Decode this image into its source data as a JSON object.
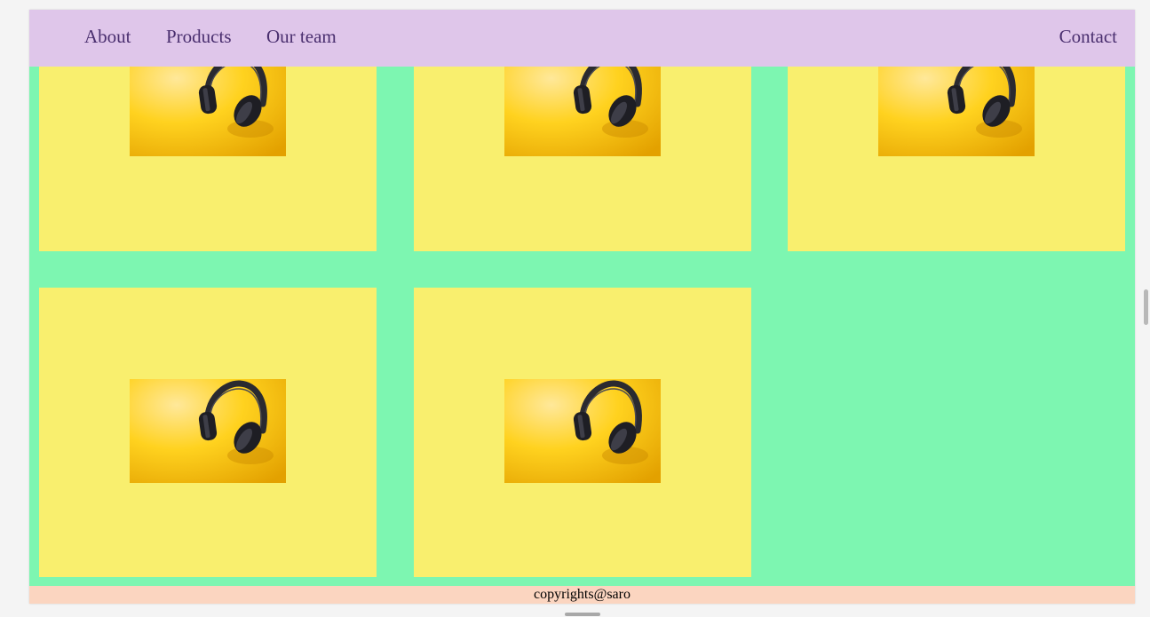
{
  "nav": {
    "about": "About",
    "products": "Products",
    "team": "Our team",
    "contact": "Contact"
  },
  "products": {
    "image": "headphones-photo",
    "count": 5
  },
  "footer": {
    "text": "copyrights@saro"
  },
  "colors": {
    "page_background": "#7df6b1",
    "card_background": "#f9ef6e",
    "navbar_background": "#dfc6ea",
    "nav_text": "#4a2f6f",
    "footer_background": "#fbd5c0"
  }
}
